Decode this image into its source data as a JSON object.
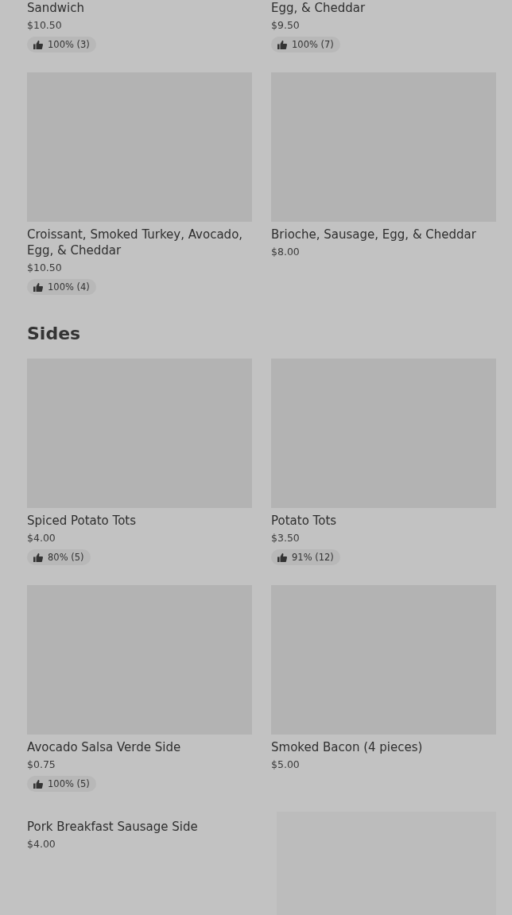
{
  "sections": [
    {
      "items": [
        {
          "kind": "cut",
          "name": "Sandwich",
          "price": "$10.50",
          "rating": "100% (3)"
        },
        {
          "kind": "cut",
          "name": "Egg, & Cheddar",
          "price": "$9.50",
          "rating": "100% (7)"
        },
        {
          "kind": "card",
          "name": "Croissant, Smoked Turkey, Avocado, Egg, & Cheddar",
          "price": "$10.50",
          "rating": "100% (4)"
        },
        {
          "kind": "card",
          "name": "Brioche, Sausage,  Egg, & Cheddar",
          "price": "$8.00"
        }
      ]
    },
    {
      "title": "Sides",
      "items": [
        {
          "kind": "card",
          "name": "Spiced Potato Tots",
          "price": "$4.00",
          "rating": "80% (5)"
        },
        {
          "kind": "card",
          "name": "Potato Tots",
          "price": "$3.50",
          "rating": "91% (12)"
        },
        {
          "kind": "card",
          "name": "Avocado Salsa Verde Side",
          "price": "$0.75",
          "rating": "100% (5)"
        },
        {
          "kind": "card",
          "name": "Smoked Bacon (4 pieces)",
          "price": "$5.00"
        },
        {
          "kind": "wide",
          "name": "Pork Breakfast Sausage Side",
          "price": "$4.00"
        }
      ]
    }
  ]
}
